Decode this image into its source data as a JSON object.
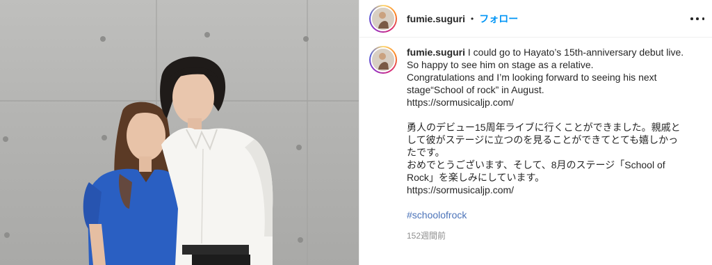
{
  "post": {
    "username": "fumie.suguri",
    "separator": "•",
    "follow_label": "フォロー",
    "more_icon": "more-options-icon"
  },
  "caption": {
    "username": "fumie.suguri",
    "en_lines": [
      "I could go to Hayato’s 15th-anniversary debut live.",
      "So happy to see him on stage as a relative.",
      "Congratulations and I’m looking forward to seeing his next",
      "stage“School of rock” in August.",
      "https://sormusicaljp.com/"
    ],
    "jp_lines": [
      "勇人のデビュー15周年ライブに行くことができました。親戚と",
      "して彼がステージに立つのを見ることができてとても嬉しかっ",
      "たです。",
      "おめでとうございます、そして、8月のステージ「School of",
      "Rock」を楽しみにしています。",
      "https://sormusicaljp.com/"
    ],
    "hashtag": "#schoolofrock",
    "timestamp": "152週間前"
  },
  "colors": {
    "accent_blue": "#0095f6",
    "hashtag_blue": "#4a72b8",
    "muted": "#8e8e8e",
    "wall": "#b4b4b2"
  }
}
